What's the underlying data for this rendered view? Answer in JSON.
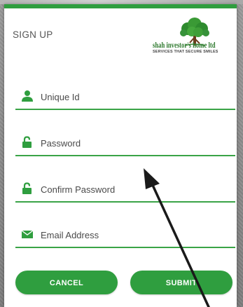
{
  "modal": {
    "title": "SIGN UP",
    "accent_color": "#2f9e3f"
  },
  "logo": {
    "name": "shah investor's home ltd",
    "tagline": "SERVICES THAT SECURE SMILES",
    "icon": "tree-icon"
  },
  "form": {
    "fields": [
      {
        "icon": "user-icon",
        "placeholder": "Unique Id",
        "value": ""
      },
      {
        "icon": "lock-icon",
        "placeholder": "Password",
        "value": ""
      },
      {
        "icon": "lock-icon",
        "placeholder": "Confirm Password",
        "value": ""
      },
      {
        "icon": "envelope-icon",
        "placeholder": "Email Address",
        "value": ""
      }
    ]
  },
  "buttons": {
    "cancel_label": "CANCEL",
    "submit_label": "SUBMIT"
  },
  "cursor": {
    "icon": "arrow-pointer-icon"
  }
}
